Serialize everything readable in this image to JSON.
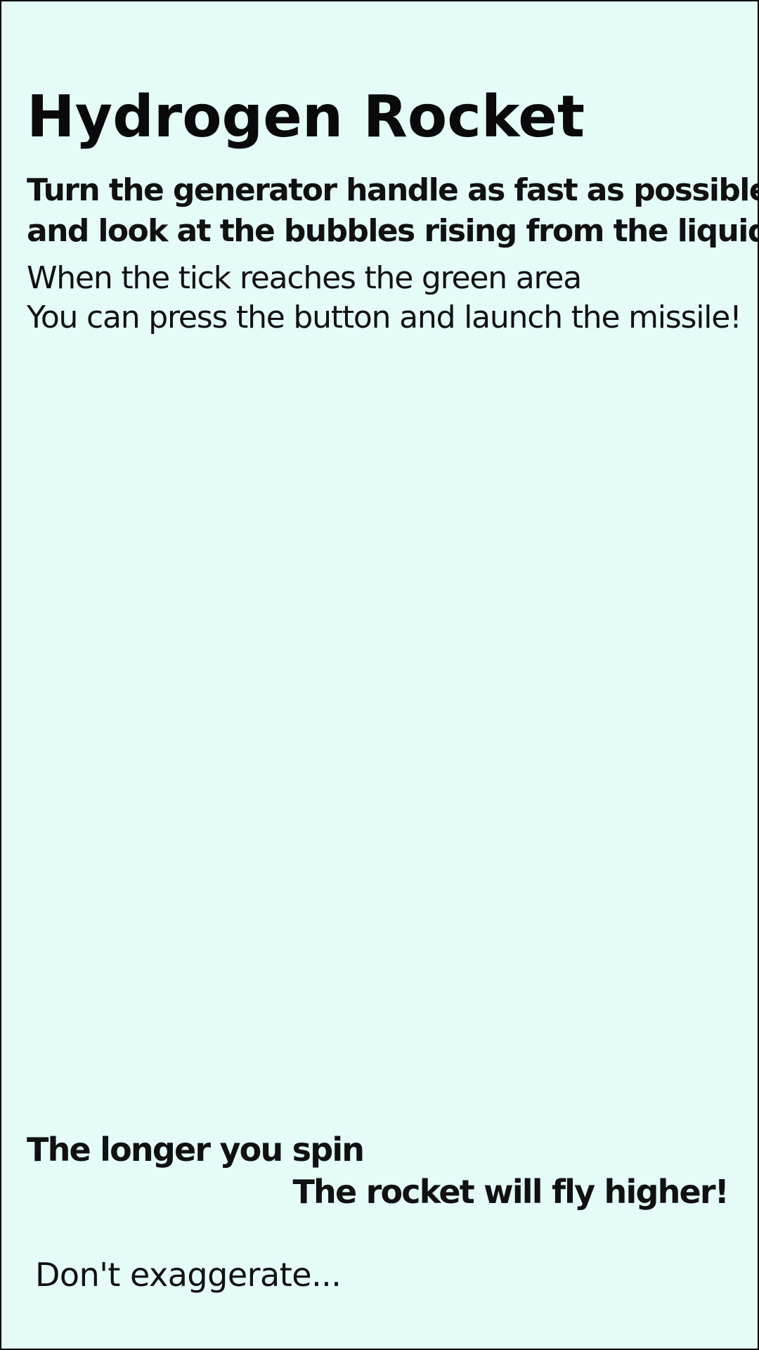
{
  "screen": {
    "background_color": "#e4fbf7",
    "border_color": "#000000"
  },
  "title": "Hydrogen Rocket",
  "subtitle": {
    "lines": [
      "Turn the generator handle as fast as possible",
      "and look at the bubbles rising from the liquid"
    ]
  },
  "instructions": {
    "lines": [
      "When the tick reaches the green area",
      "You can press the button and launch the missile!"
    ]
  },
  "hints": {
    "left": "The longer you spin",
    "right": "The rocket will fly higher!"
  },
  "warning": "Don't exaggerate..."
}
